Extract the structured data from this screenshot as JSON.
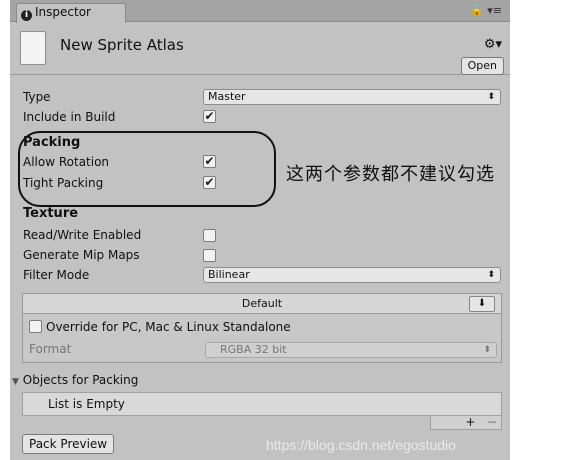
{
  "tab": {
    "label": "Inspector"
  },
  "header": {
    "title": "New Sprite Atlas",
    "open_label": "Open"
  },
  "fields": {
    "type_label": "Type",
    "type_value": "Master",
    "include_label": "Include in Build",
    "packing_header": "Packing",
    "allow_rotation_label": "Allow Rotation",
    "tight_packing_label": "Tight Packing",
    "texture_header": "Texture",
    "read_write_label": "Read/Write Enabled",
    "mipmaps_label": "Generate Mip Maps",
    "filter_label": "Filter Mode",
    "filter_value": "Bilinear"
  },
  "checks": {
    "include": "✔",
    "allow_rotation": "✔",
    "tight_packing": "✔"
  },
  "platform": {
    "tab_label": "Default",
    "override_label": "Override for PC, Mac & Linux Standalone",
    "format_label": "Format",
    "format_value": "RGBA 32 bit"
  },
  "objects": {
    "header": "Objects for Packing",
    "empty_text": "List is Empty",
    "add": "+",
    "remove": "−"
  },
  "pack_preview_label": "Pack Preview",
  "watermark": "https://blog.csdn.net/egostudio",
  "annotation": "这两个参数都不建议勾选"
}
